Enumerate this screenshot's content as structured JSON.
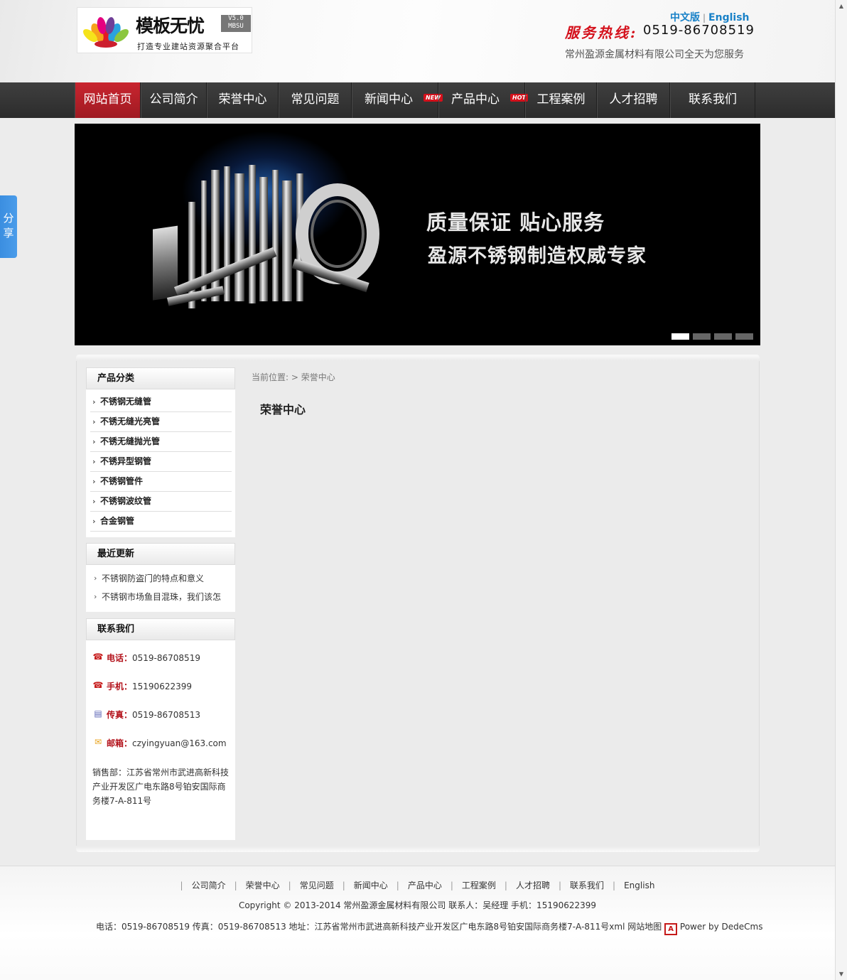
{
  "header": {
    "logo_title": "模板无忧",
    "logo_version": "V5.0 MBSU",
    "logo_subtitle": "打造专业建站资源聚合平台",
    "lang_cn": "中文版",
    "lang_sep": "|",
    "lang_en": "English",
    "hotline_label": "服务热线:",
    "hotline_number": "0519-86708519",
    "service_text": "常州盈源金属材料有限公司全天为您服务"
  },
  "nav": {
    "items": [
      {
        "label": "网站首页",
        "active": true
      },
      {
        "label": "公司简介"
      },
      {
        "label": "荣誉中心"
      },
      {
        "label": "常见问题"
      },
      {
        "label": "新闻中心",
        "badge": "NEW"
      },
      {
        "label": "产品中心",
        "badge": "HOT"
      },
      {
        "label": "工程案例"
      },
      {
        "label": "人才招聘"
      },
      {
        "label": "联系我们"
      }
    ]
  },
  "banner": {
    "line1": "质量保证  贴心服务",
    "line2": "盈源不锈钢制造权威专家",
    "active_slide": 1,
    "slide_count": 4
  },
  "share": {
    "label": "分享"
  },
  "sidebar": {
    "categories": {
      "title": "产品分类",
      "items": [
        "不锈钢无缝管",
        "不锈无缝光亮管",
        "不锈无缝抛光管",
        "不锈异型钢管",
        "不锈钢管件",
        "不锈钢波纹管",
        "合金钢管"
      ]
    },
    "recent": {
      "title": "最近更新",
      "items": [
        "不锈钢防盗门的特点和意义",
        "不锈钢市场鱼目混珠，我们该怎"
      ]
    },
    "contact": {
      "title": "联系我们",
      "phone_label": "电话：",
      "phone": "0519-86708519",
      "mobile_label": "手机：",
      "mobile": "15190622399",
      "fax_label": "传真：",
      "fax": "0519-86708513",
      "email_label": "邮箱：",
      "email": "czyingyuan@163.com",
      "address": "销售部：江苏省常州市武进高新科技产业开发区广电东路8号铂安国际商务楼7-A-811号"
    }
  },
  "content": {
    "breadcrumb": "当前位置: > 荣誉中心",
    "heading": "荣誉中心"
  },
  "footer": {
    "links": [
      "公司简介",
      "荣誉中心",
      "常见问题",
      "新闻中心",
      "产品中心",
      "工程案例",
      "人才招聘",
      "联系我们",
      "English"
    ],
    "copyright": "Copyright © 2013-2014 常州盈源金属材料有限公司  联系人：吴经理  手机：15190622399",
    "info": "电话：0519-86708519 传真：0519-86708513 地址：江苏省常州市武进高新科技产业开发区广电东路8号铂安国际商务楼7-A-811号xml 网站地图",
    "power": "Power by DedeCms"
  },
  "icons": {
    "phone": "phone-icon",
    "mobile": "phone-icon",
    "fax": "fax-icon",
    "email": "envelope-icon"
  },
  "colors": {
    "accent_red": "#c9252f",
    "nav_bg": "#333333",
    "link_blue": "#1a82c8"
  }
}
